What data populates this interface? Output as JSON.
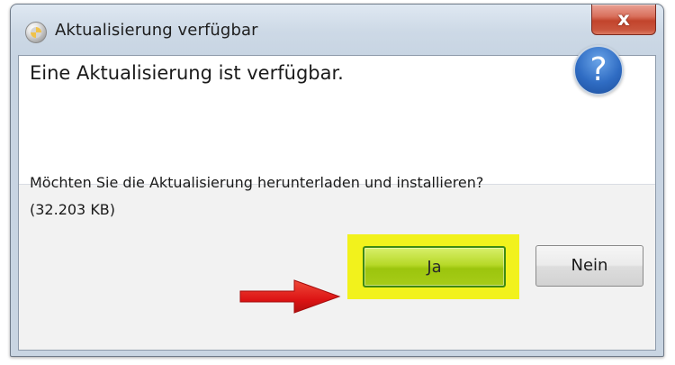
{
  "window": {
    "title": "Aktualisierung verfügbar",
    "close_label": "x"
  },
  "dialog": {
    "main_instruction": "Eine Aktualisierung ist verfügbar.",
    "question_mark": "?",
    "content_line1": "Möchten Sie die Aktualisierung herunterladen und installieren?",
    "content_line2": "(32.203 KB)"
  },
  "buttons": {
    "yes_label": "Ja",
    "no_label": "Nein"
  },
  "colors": {
    "highlight": "#f2f21c",
    "arrow": "#e41f1f",
    "yes_button": "#9cc50d",
    "close_button": "#c9553d",
    "question_icon": "#2f6cc3"
  },
  "icons": {
    "app_icon": "update-app-icon",
    "question_icon": "question-mark-icon",
    "annotation": "red-arrow-icon"
  }
}
